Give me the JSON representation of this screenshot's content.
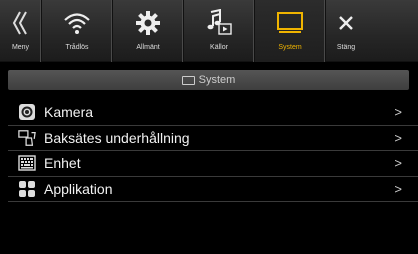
{
  "topbar": {
    "tabs": [
      {
        "id": "meny",
        "label": "Meny",
        "icon": "double-chevron-left-icon"
      },
      {
        "id": "tradlos",
        "label": "Trådlös",
        "icon": "wifi-icon"
      },
      {
        "id": "allmant",
        "label": "Allmänt",
        "icon": "gear-icon"
      },
      {
        "id": "kallor",
        "label": "Källor",
        "icon": "music-note-icon"
      },
      {
        "id": "system",
        "label": "System",
        "icon": "monitor-icon",
        "active": true
      },
      {
        "id": "stang",
        "label": "Stäng",
        "icon": "close-icon"
      }
    ]
  },
  "section": {
    "title": "System",
    "icon": "monitor-icon"
  },
  "list": {
    "items": [
      {
        "label": "Kamera",
        "icon": "camera-icon"
      },
      {
        "label": "Baksätes underhållning",
        "icon": "rear-entertainment-icon"
      },
      {
        "label": "Enhet",
        "icon": "keyboard-icon"
      },
      {
        "label": "Applikation",
        "icon": "apps-grid-icon"
      }
    ],
    "chevron": ">"
  },
  "colors": {
    "accent": "#f0b400",
    "background": "#000000",
    "bar": "#2a2a2a"
  }
}
